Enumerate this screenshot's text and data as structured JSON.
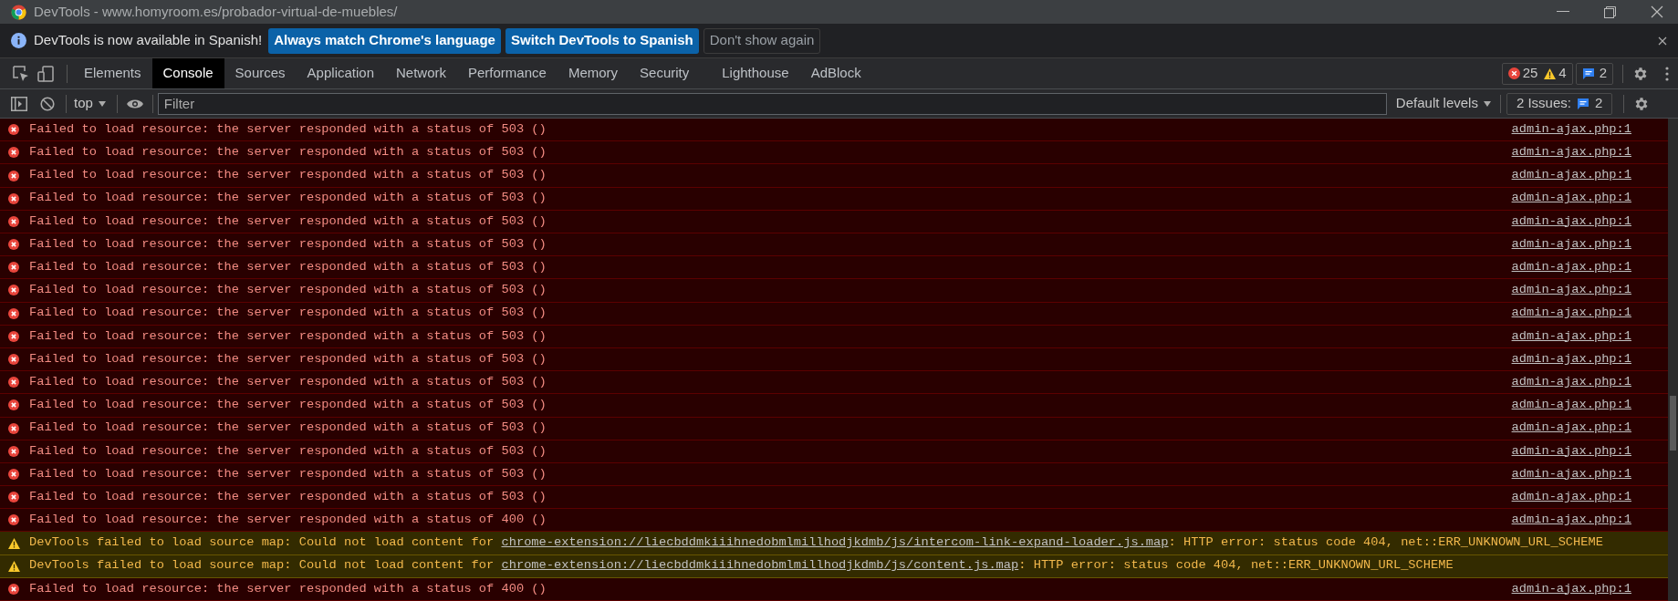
{
  "window": {
    "title": "DevTools - www.homyroom.es/probador-virtual-de-muebles/"
  },
  "infobar": {
    "message": "DevTools is now available in Spanish!",
    "buttons": [
      {
        "label": "Always match Chrome's language",
        "kind": "primary"
      },
      {
        "label": "Switch DevTools to Spanish",
        "kind": "primary"
      },
      {
        "label": "Don't show again",
        "kind": "plain"
      }
    ]
  },
  "tabs": [
    {
      "label": "Elements",
      "selected": false
    },
    {
      "label": "Console",
      "selected": true
    },
    {
      "label": "Sources",
      "selected": false
    },
    {
      "label": "Application",
      "selected": false
    },
    {
      "label": "Network",
      "selected": false
    },
    {
      "label": "Performance",
      "selected": false
    },
    {
      "label": "Memory",
      "selected": false
    },
    {
      "label": "Security",
      "selected": false
    },
    {
      "label": "Lighthouse",
      "selected": false
    },
    {
      "label": "AdBlock",
      "selected": false
    }
  ],
  "counters": {
    "errors": "25",
    "warnings": "4",
    "issues": "2"
  },
  "console_toolbar": {
    "context": "top",
    "filter_placeholder": "Filter",
    "levels": "Default levels",
    "issues_label": "2 Issues:",
    "issues_count": "2"
  },
  "messages": [
    {
      "kind": "error",
      "text": "Failed to load resource: the server responded with a status of 503 ()",
      "source": "admin-ajax.php:1"
    },
    {
      "kind": "error",
      "text": "Failed to load resource: the server responded with a status of 503 ()",
      "source": "admin-ajax.php:1"
    },
    {
      "kind": "error",
      "text": "Failed to load resource: the server responded with a status of 503 ()",
      "source": "admin-ajax.php:1"
    },
    {
      "kind": "error",
      "text": "Failed to load resource: the server responded with a status of 503 ()",
      "source": "admin-ajax.php:1"
    },
    {
      "kind": "error",
      "text": "Failed to load resource: the server responded with a status of 503 ()",
      "source": "admin-ajax.php:1"
    },
    {
      "kind": "error",
      "text": "Failed to load resource: the server responded with a status of 503 ()",
      "source": "admin-ajax.php:1"
    },
    {
      "kind": "error",
      "text": "Failed to load resource: the server responded with a status of 503 ()",
      "source": "admin-ajax.php:1"
    },
    {
      "kind": "error",
      "text": "Failed to load resource: the server responded with a status of 503 ()",
      "source": "admin-ajax.php:1"
    },
    {
      "kind": "error",
      "text": "Failed to load resource: the server responded with a status of 503 ()",
      "source": "admin-ajax.php:1"
    },
    {
      "kind": "error",
      "text": "Failed to load resource: the server responded with a status of 503 ()",
      "source": "admin-ajax.php:1"
    },
    {
      "kind": "error",
      "text": "Failed to load resource: the server responded with a status of 503 ()",
      "source": "admin-ajax.php:1"
    },
    {
      "kind": "error",
      "text": "Failed to load resource: the server responded with a status of 503 ()",
      "source": "admin-ajax.php:1"
    },
    {
      "kind": "error",
      "text": "Failed to load resource: the server responded with a status of 503 ()",
      "source": "admin-ajax.php:1"
    },
    {
      "kind": "error",
      "text": "Failed to load resource: the server responded with a status of 503 ()",
      "source": "admin-ajax.php:1"
    },
    {
      "kind": "error",
      "text": "Failed to load resource: the server responded with a status of 503 ()",
      "source": "admin-ajax.php:1"
    },
    {
      "kind": "error",
      "text": "Failed to load resource: the server responded with a status of 503 ()",
      "source": "admin-ajax.php:1"
    },
    {
      "kind": "error",
      "text": "Failed to load resource: the server responded with a status of 503 ()",
      "source": "admin-ajax.php:1"
    },
    {
      "kind": "error",
      "text": "Failed to load resource: the server responded with a status of 400 ()",
      "source": "admin-ajax.php:1"
    },
    {
      "kind": "warning",
      "text": "DevTools failed to load source map: Could not load content for ",
      "link": "chrome-extension://liecbddmkiiihnedobmlmillhodjkdmb/js/intercom-link-expand-loader.js.map",
      "text_after": ": HTTP error: status code 404, net::ERR_UNKNOWN_URL_SCHEME"
    },
    {
      "kind": "warning",
      "text": "DevTools failed to load source map: Could not load content for ",
      "link": "chrome-extension://liecbddmkiiihnedobmlmillhodjkdmb/js/content.js.map",
      "text_after": ": HTTP error: status code 404, net::ERR_UNKNOWN_URL_SCHEME"
    },
    {
      "kind": "error",
      "text": "Failed to load resource: the server responded with a status of 400 ()",
      "source": "admin-ajax.php:1"
    }
  ]
}
